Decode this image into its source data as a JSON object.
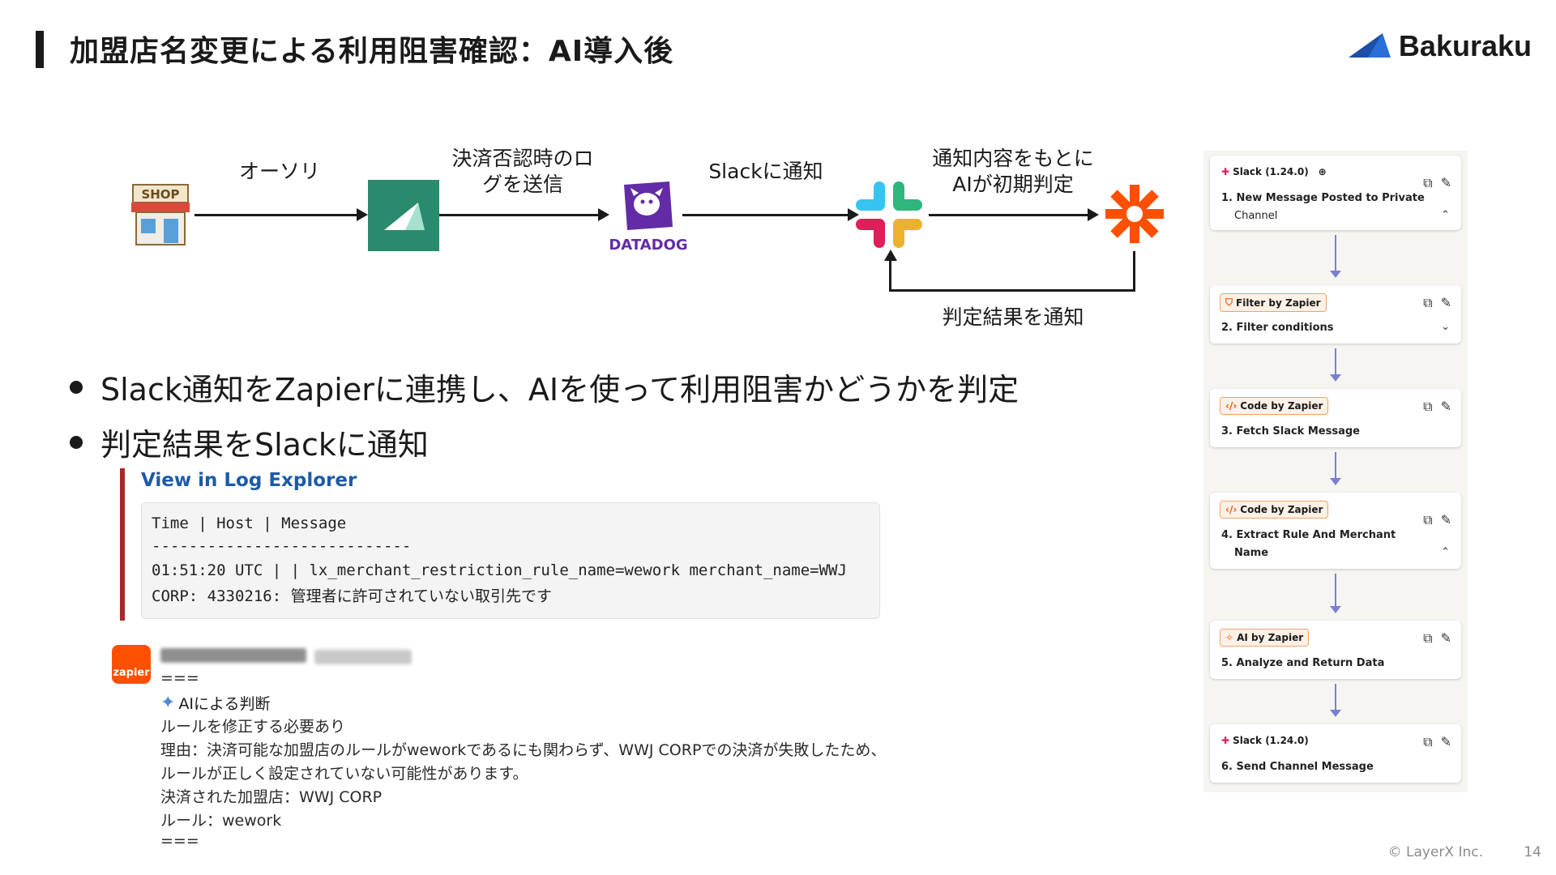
{
  "header": {
    "title": "加盟店名変更による利用阻害確認：AI導入後",
    "logo_text": "Bakuraku"
  },
  "flow": {
    "shop_label": "SHOP",
    "edge1": "オーソリ",
    "edge2_line1": "決済否認時のロ",
    "edge2_line2": "グを送信",
    "datadog_label": "DATADOG",
    "edge3": "Slackに通知",
    "edge4_line1": "通知内容をもとに",
    "edge4_line2": "AIが初期判定",
    "edge_back": "判定結果を通知"
  },
  "bullets": [
    "Slack通知をZapierに連携し、AIを使って利用阻害かどうかを判定",
    "判定結果をSlackに通知"
  ],
  "log": {
    "link": "View in Log Explorer",
    "header": "Time | Host | Message",
    "divider": "----------------------------",
    "line1": "01:51:20 UTC |  | lx_merchant_restriction_rule_name=wework merchant_name=WWJ",
    "line2": "CORP: 4330216: 管理者に許可されていない取引先です"
  },
  "message": {
    "avatar": "zapier",
    "sep_top": "===",
    "ai_heading": "AIによる判断",
    "line1": "ルールを修正する必要あり",
    "line2": "理由：決済可能な加盟店のルールがweworkであるにも関わらず、WWJ CORPでの決済が失敗したため、",
    "line3": "ルールが正しく設定されていない可能性があります。",
    "line4": "決済された加盟店：WWJ CORP",
    "line5": "ルール：wework",
    "sep_bottom": "==="
  },
  "zap_steps": [
    {
      "app": "Slack (1.24.0)",
      "step_line1": "1. New Message Posted to Private",
      "step_line2": "Channel",
      "chevron": "up"
    },
    {
      "app": "Filter by Zapier",
      "step_line1": "2. Filter conditions",
      "step_line2": "",
      "chevron": "down"
    },
    {
      "app": "Code by Zapier",
      "step_line1": "3. Fetch Slack Message",
      "step_line2": "",
      "chevron": ""
    },
    {
      "app": "Code by Zapier",
      "step_line1": "4. Extract Rule And Merchant",
      "step_line2": "Name",
      "chevron": "up"
    },
    {
      "app": "AI by Zapier",
      "step_line1": "5. Analyze and Return Data",
      "step_line2": "",
      "chevron": ""
    },
    {
      "app": "Slack (1.24.0)",
      "step_line1": "6. Send Channel Message",
      "step_line2": "",
      "chevron": ""
    }
  ],
  "footer": {
    "copyright": "© LayerX Inc.",
    "page": "14"
  },
  "colors": {
    "bakuraku_green": "#2a8a6e",
    "datadog_purple": "#632ca6",
    "zapier_orange": "#ff4f00",
    "log_link_blue": "#1d5aa8"
  }
}
